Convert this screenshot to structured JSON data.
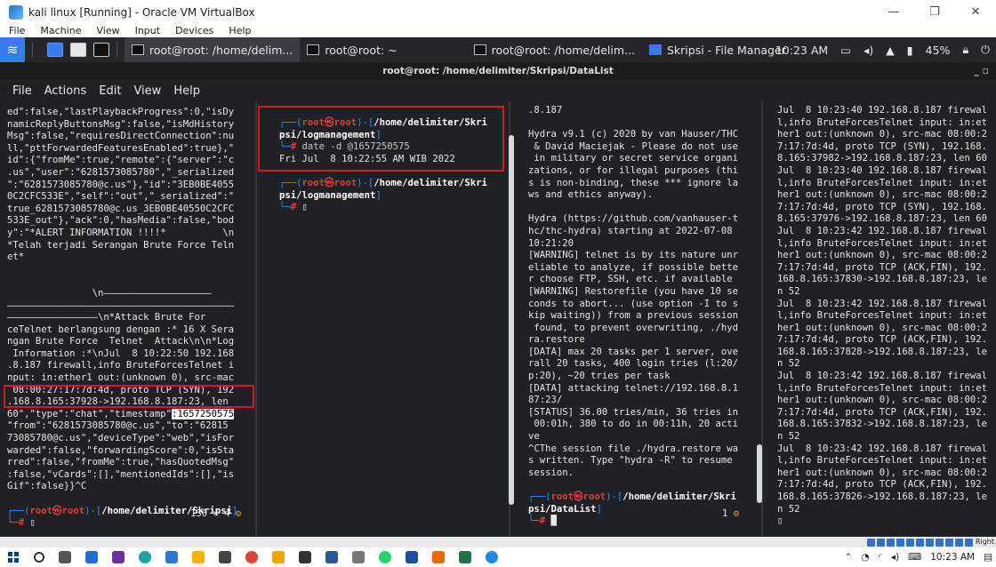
{
  "vbox": {
    "title": "kali linux [Running] - Oracle VM VirtualBox",
    "menu": [
      "File",
      "Machine",
      "View",
      "Input",
      "Devices",
      "Help"
    ]
  },
  "kali_panel": {
    "tasks": [
      "root@root: /home/delim...",
      "root@root: ~",
      "root@root: /home/delim...",
      "Skripsi - File Manager"
    ],
    "clock": "10:23 AM",
    "battery": "45%"
  },
  "terminal": {
    "title": "root@root: /home/delimiter/Skripsi/DataList",
    "menu": [
      "File",
      "Actions",
      "Edit",
      "View",
      "Help"
    ]
  },
  "pane1": {
    "text_top": "ed\":false,\"lastPlaybackProgress\":0,\"isDy\nnamicReplyButtonsMsg\":false,\"isMdHistory\nMsg\":false,\"requiresDirectConnection\":nu\nll,\"pttForwardedFeaturesEnabled\":true},\"\nid\":{\"fromMe\":true,\"remote\":{\"server\":\"c\n.us\",\"user\":\"6281573085780\",\"_serialized\n\":\"6281573085780@c.us\"},\"id\":\"3EB0BE4055\n0C2CFC533E\",\"self\":\"out\",\"_serialized\":\"\ntrue_6281573085780@c.us_3EB0BE40550C2CFC\n533E_out\"},\"ack\":0,\"hasMedia\":false,\"bod\ny\":\"*ALERT INFORMATION !!!!*          \\n\n*Telah terjadi Serangan Brute Force Teln\net*\n\n\n               \\n———————————————————\n————————————————————————————————————————\n————————————————\\n*Attack Brute For\nceTelnet berlangsung dengan :* 16 X Sera\nngan Brute Force  Telnet  Attack\\n\\n*Log\n Information :*\\nJul  8 10:22:50 192.168\n.8.187 firewall,info BruteForcesTelnet i\nnput: in:ether1 out:(unknown 0), src-mac\n 08:00:27:17:7d:4d, proto TCP (SYN), 192\n.168.8.165:37928->192.168.8.187:23, len",
    "hl_prefix": "60\",\"type\":\"chat\",\"timestamp\"",
    "hl_value": ":1657250575",
    "text_bottom": "\"from\":\"6281573085780@c.us\",\"to\":\"62815\n73085780@c.us\",\"deviceType\":\"web\",\"isFor\nwarded\":false,\"forwardingScore\":0,\"isSta\nrred\":false,\"fromMe\":true,\"hasQuotedMsg\"\n:false,\"vCards\":[],\"mentionedIds\":[],\"is\nGif\":false}}^C",
    "prompt_user": "root",
    "prompt_host": "root",
    "prompt_path": "/home/delimiter/Skripsi",
    "counter": "130 × 4"
  },
  "pane2": {
    "prompt1_user": "root",
    "prompt1_host": "root",
    "prompt1_path_a": "/home/delimiter/Skri",
    "prompt1_path_b": "psi/logmanagement",
    "command": "date -d @1657250575",
    "output": "Fri Jul  8 10:22:55 AM WIB 2022",
    "prompt2_user": "root",
    "prompt2_host": "root",
    "prompt2_path_a": "/home/delimiter/Skri",
    "prompt2_path_b": "psi/logmanagement"
  },
  "pane3": {
    "text": ".8.187\n\nHydra v9.1 (c) 2020 by van Hauser/THC\n & David Maciejak - Please do not use\n in military or secret service organi\nzations, or for illegal purposes (thi\ns is non-binding, these *** ignore la\nws and ethics anyway).\n\nHydra (https://github.com/vanhauser-t\nhc/thc-hydra) starting at 2022-07-08\n10:21:20\n[WARNING] telnet is by its nature unr\neliable to analyze, if possible bette\nr choose FTP, SSH, etc. if available\n[WARNING] Restorefile (you have 10 se\nconds to abort... (use option -I to s\nkip waiting)) from a previous session\n found, to prevent overwriting, ./hyd\nra.restore\n[DATA] max 20 tasks per 1 server, ove\nrall 20 tasks, 400 login tries (l:20/\np:20), ~20 tries per task\n[DATA] attacking telnet://192.168.8.1\n87:23/\n[STATUS] 36.00 tries/min, 36 tries in\n 00:01h, 380 to do in 00:11h, 20 acti\nve\n^CThe session file ./hydra.restore wa\ns written. Type \"hydra -R\" to resume\nsession.",
    "prompt_user": "root",
    "prompt_host": "root",
    "prompt_path_a": "/home/delimiter/Skri",
    "prompt_path_b": "psi/DataList",
    "counter": "1"
  },
  "pane4": {
    "text": "Jul  8 10:23:40 192.168.8.187 firewal\nl,info BruteForcesTelnet input: in:et\nher1 out:(unknown 0), src-mac 08:00:2\n7:17:7d:4d, proto TCP (SYN), 192.168.\n8.165:37982->192.168.8.187:23, len 60\nJul  8 10:23:40 192.168.8.187 firewal\nl,info BruteForcesTelnet input: in:et\nher1 out:(unknown 0), src-mac 08:00:2\n7:17:7d:4d, proto TCP (SYN), 192.168.\n8.165:37976->192.168.8.187:23, len 60\nJul  8 10:23:42 192.168.8.187 firewal\nl,info BruteForcesTelnet input: in:et\nher1 out:(unknown 0), src-mac 08:00:2\n7:17:7d:4d, proto TCP (ACK,FIN), 192.\n168.8.165:37830->192.168.8.187:23, le\nn 52\nJul  8 10:23:42 192.168.8.187 firewal\nl,info BruteForcesTelnet input: in:et\nher1 out:(unknown 0), src-mac 08:00:2\n7:17:7d:4d, proto TCP (ACK,FIN), 192.\n168.8.165:37828->192.168.8.187:23, le\nn 52\nJul  8 10:23:42 192.168.8.187 firewal\nl,info BruteForcesTelnet input: in:et\nher1 out:(unknown 0), src-mac 08:00:2\n7:17:7d:4d, proto TCP (ACK,FIN), 192.\n168.8.165:37832->192.168.8.187:23, le\nn 52\nJul  8 10:23:42 192.168.8.187 firewal\nl,info BruteForcesTelnet input: in:et\nher1 out:(unknown 0), src-mac 08:00:2\n7:17:7d:4d, proto TCP (ACK,FIN), 192.\n168.8.165:37826->192.168.8.187:23, le\nn 52"
  },
  "vbox_status": {
    "right_ctrl": "Right"
  },
  "win_taskbar": {
    "clock": "10:23 AM"
  }
}
